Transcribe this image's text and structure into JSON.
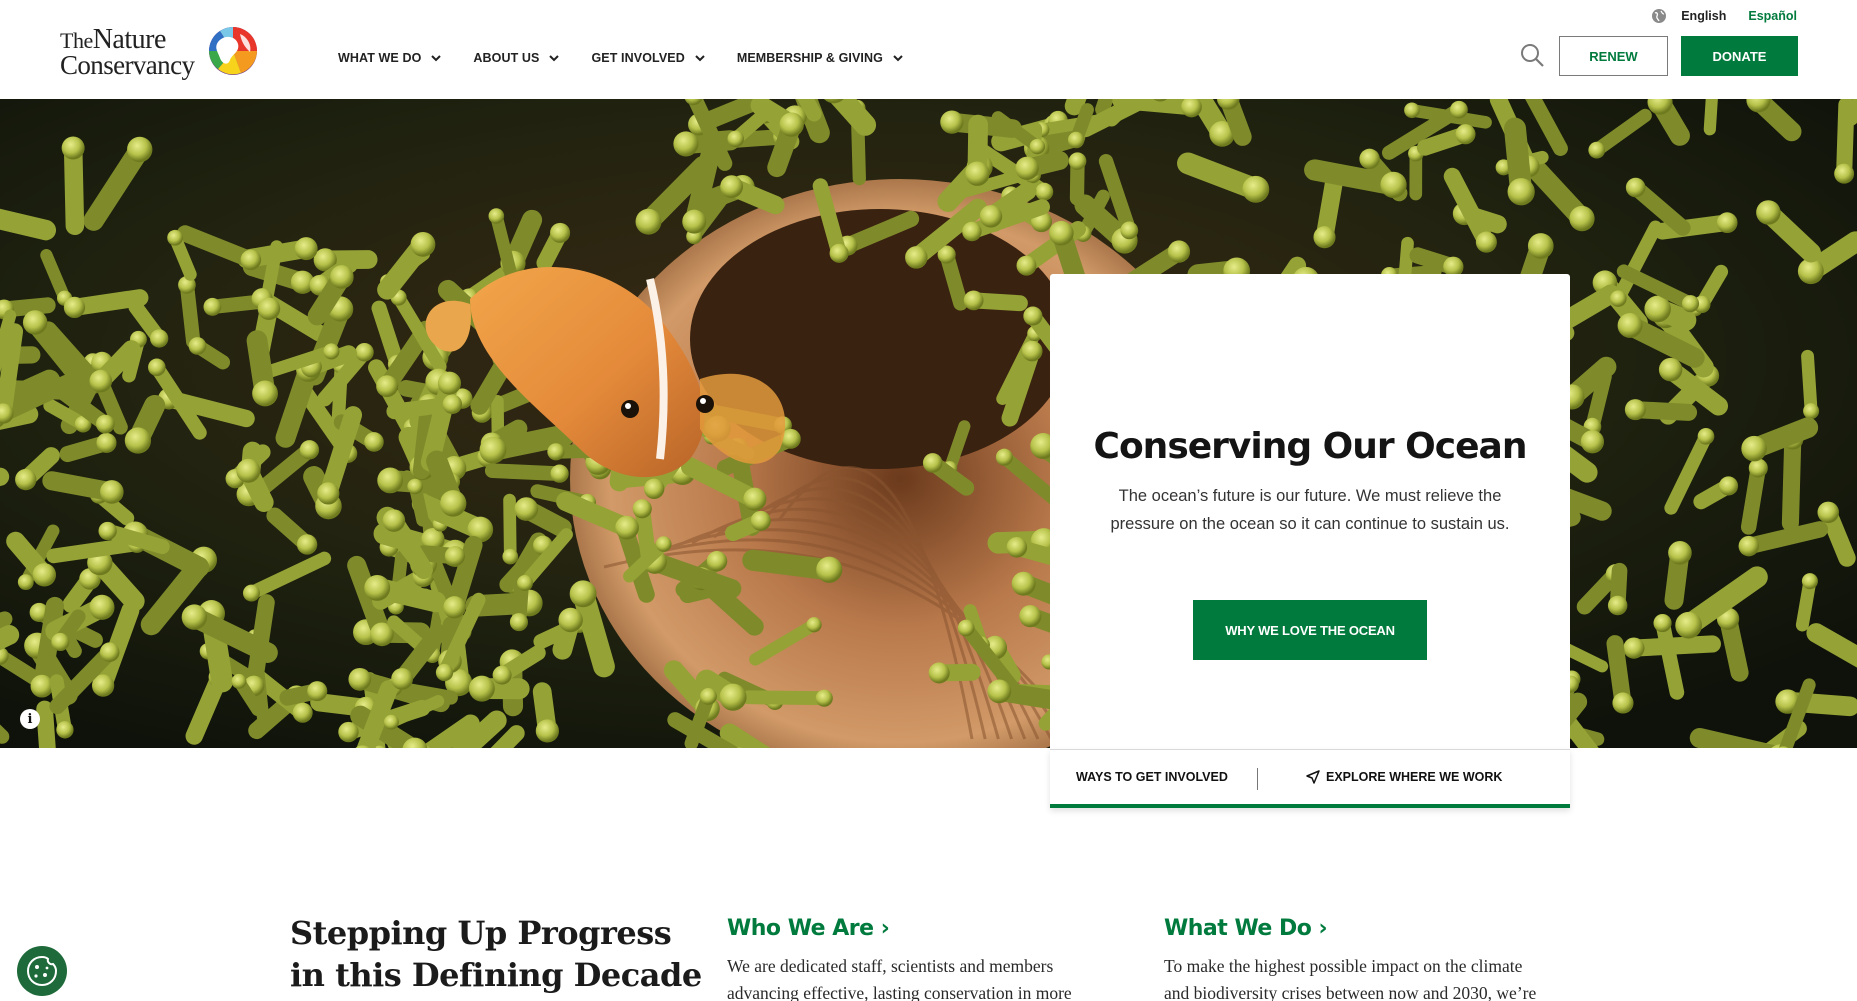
{
  "brand": {
    "line1_prefix": "The",
    "line1_main": "Nature",
    "line2": "Conservancy"
  },
  "nav": {
    "items": [
      {
        "label": "WHAT WE DO"
      },
      {
        "label": "ABOUT US"
      },
      {
        "label": "GET INVOLVED"
      },
      {
        "label": "MEMBERSHIP & GIVING"
      }
    ]
  },
  "language": {
    "current": "English",
    "alternate": "Español"
  },
  "header_actions": {
    "search_icon": "search-icon",
    "renew_label": "RENEW",
    "donate_label": "DONATE"
  },
  "hero": {
    "image_subject": "clownfish-in-anemone",
    "info_icon": "i",
    "card": {
      "title": "Conserving Our Ocean",
      "description": "The ocean’s future is our future. We must relieve the pressure on the ocean so it can continue to sustain us.",
      "button_label": "WHY WE LOVE THE OCEAN"
    },
    "footer_links": {
      "left": "WAYS TO GET INVOLVED",
      "right": "EXPLORE WHERE WE WORK"
    }
  },
  "section": {
    "title_line1": "Stepping Up Progress",
    "title_line2": "in this Defining Decade",
    "columns": [
      {
        "heading": "Who We Are ›",
        "text_line1": "We are dedicated staff, scientists and members",
        "text_line2": "advancing effective, lasting conservation in more"
      },
      {
        "heading": "What We Do ›",
        "text_line1": "To make the highest possible impact on the climate",
        "text_line2": "and biodiversity crises between now and 2030, we’re"
      }
    ]
  },
  "colors": {
    "brand_green": "#007a3d",
    "cookie_green": "#1e6a3a",
    "text_dark": "#1b1b1b"
  }
}
